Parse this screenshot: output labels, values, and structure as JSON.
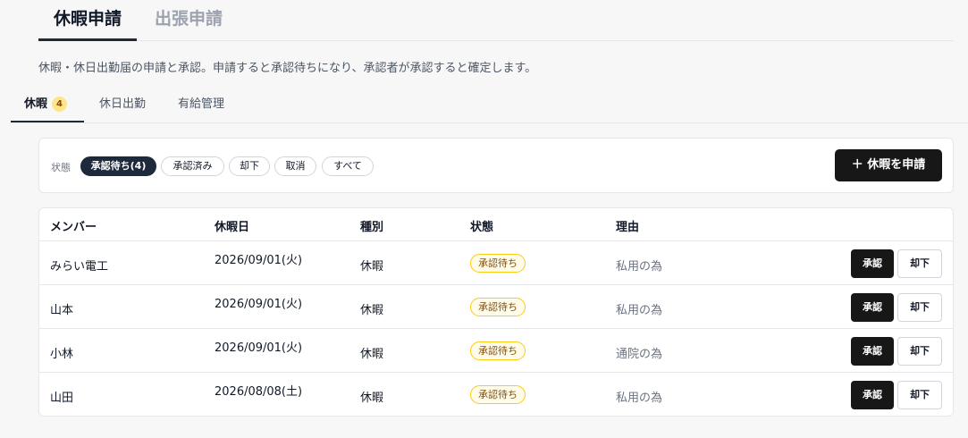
{
  "main_tabs": [
    {
      "label": "休暇申請",
      "active": true
    },
    {
      "label": "出張申請",
      "active": false
    }
  ],
  "description": "休暇・休日出勤届の申請と承認。申請すると承認待ちになり、承認者が承認すると確定します。",
  "sub_tabs": [
    {
      "label": "休暇",
      "badge": "4",
      "active": true
    },
    {
      "label": "休日出勤",
      "active": false
    },
    {
      "label": "有給管理",
      "active": false
    }
  ],
  "filter": {
    "label": "状態",
    "chips": [
      {
        "label": "承認待ち(4)",
        "active": true
      },
      {
        "label": "承認済み",
        "active": false
      },
      {
        "label": "却下",
        "active": false
      },
      {
        "label": "取消",
        "active": false
      },
      {
        "label": "すべて",
        "active": false
      }
    ],
    "new_button": "＋ 休暇を申請"
  },
  "table": {
    "headers": [
      "メンバー",
      "休暇日",
      "種別",
      "状態",
      "理由"
    ],
    "rows": [
      {
        "member": "みらい電工",
        "date": "2026/09/01(火)",
        "type": "休暇",
        "status": "承認待ち",
        "reason": "私用の為"
      },
      {
        "member": "山本",
        "date": "2026/09/01(火)",
        "type": "休暇",
        "status": "承認待ち",
        "reason": "私用の為"
      },
      {
        "member": "小林",
        "date": "2026/09/01(火)",
        "type": "休暇",
        "status": "承認待ち",
        "reason": "通院の為"
      },
      {
        "member": "山田",
        "date": "2026/08/08(土)",
        "type": "休暇",
        "status": "承認待ち",
        "reason": "私用の為"
      }
    ],
    "approve_label": "承認",
    "reject_label": "却下"
  },
  "colors": {
    "primary": "#171717",
    "accent_dark": "#1e293b",
    "pending_bg": "#fefce8",
    "pending_border": "#facc15",
    "badge_bg": "#fde68a"
  }
}
